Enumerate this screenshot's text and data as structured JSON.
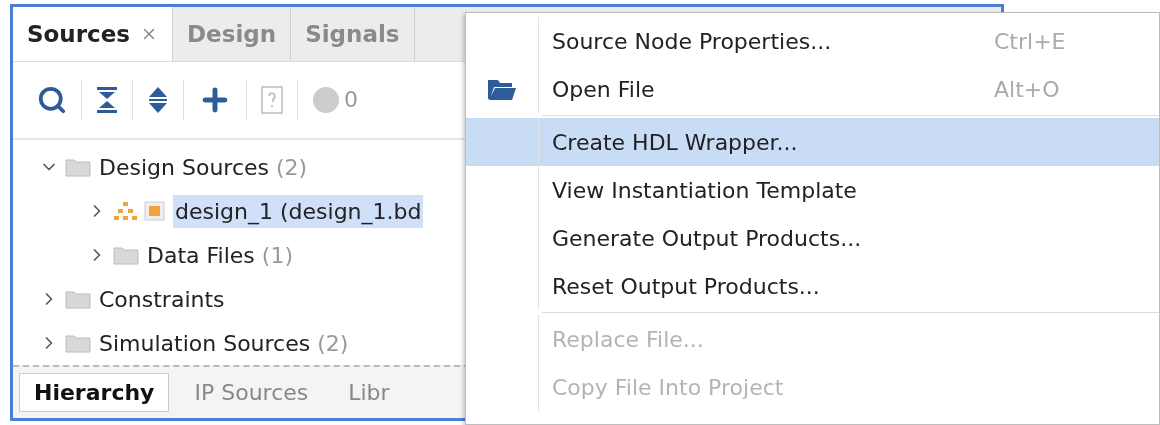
{
  "panel": {
    "tabs": [
      {
        "label": "Sources",
        "selected": true,
        "closable": true
      },
      {
        "label": "Design",
        "selected": false,
        "closable": false
      },
      {
        "label": "Signals",
        "selected": false,
        "closable": false
      }
    ],
    "toolbar": {
      "counter": "0"
    },
    "tree": [
      {
        "kind": "folder",
        "label": "Design Sources",
        "count": "(2)",
        "expanded": true,
        "selected": false,
        "children": [
          {
            "kind": "design",
            "label": "design_1 (design_1.bd",
            "expanded": false,
            "selected": true
          },
          {
            "kind": "folder",
            "label": "Data Files",
            "count": "(1)",
            "expanded": false,
            "selected": false
          }
        ]
      },
      {
        "kind": "folder",
        "label": "Constraints",
        "expanded": false,
        "selected": false
      },
      {
        "kind": "folder",
        "label": "Simulation Sources",
        "count": "(2)",
        "expanded": false,
        "selected": false
      }
    ],
    "bottom_tabs": [
      {
        "label": "Hierarchy",
        "selected": true
      },
      {
        "label": "IP Sources",
        "selected": false
      },
      {
        "label": "Libr",
        "selected": false
      }
    ]
  },
  "context_menu": {
    "items": [
      {
        "kind": "text",
        "label": "Source Node Properties...",
        "shortcut": "Ctrl+E",
        "disabled": false,
        "selected": false
      },
      {
        "kind": "icon",
        "label": "Open File",
        "shortcut": "Alt+O",
        "disabled": false,
        "selected": false
      },
      {
        "kind": "separator"
      },
      {
        "kind": "text",
        "label": "Create HDL Wrapper...",
        "disabled": false,
        "selected": true
      },
      {
        "kind": "text",
        "label": "View Instantiation Template",
        "disabled": false,
        "selected": false
      },
      {
        "kind": "text",
        "label": "Generate Output Products...",
        "disabled": false,
        "selected": false
      },
      {
        "kind": "text",
        "label": "Reset Output Products...",
        "disabled": false,
        "selected": false
      },
      {
        "kind": "separator"
      },
      {
        "kind": "text",
        "label": "Replace File...",
        "disabled": true,
        "selected": false
      },
      {
        "kind": "text",
        "label": "Copy File Into Project",
        "disabled": true,
        "selected": false
      }
    ]
  }
}
